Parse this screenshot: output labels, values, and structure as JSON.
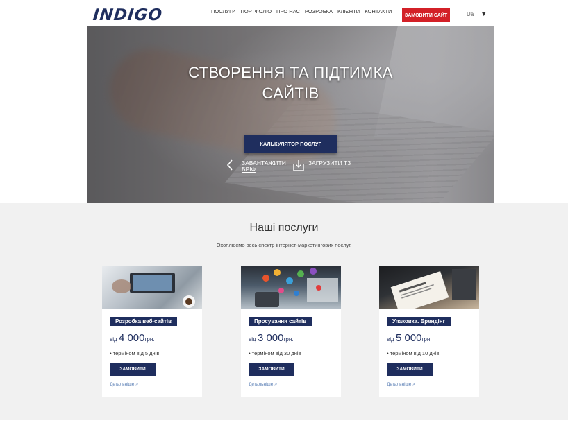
{
  "header": {
    "logo": "INDIGO",
    "nav": [
      "ПОСЛУГИ",
      "ПОРТФОЛІО",
      "ПРО НАС",
      "РОЗРОБКА",
      "КЛІЄНТИ",
      "КОНТАКТИ"
    ],
    "order_label": "ЗАМОВИТИ САЙТ",
    "lang": "Ua"
  },
  "hero": {
    "title_line1": "СТВОРЕННЯ ТА ПІДТИМКА",
    "title_line2": "САЙТІВ",
    "calc_label": "КАЛЬКУЛЯТОР ПОСЛУГ",
    "download_line1": "ЗАВАНТАЖИТИ",
    "download_line2": "БРІФ",
    "upload_label": "ЗАГРУЗИТИ ТЗ"
  },
  "services": {
    "title": "Наші послуги",
    "subtitle": "Охоплюємо весь спектр інтернет-маркетингових послуг.",
    "cards": [
      {
        "name": "Розробка веб-сайтів",
        "from": "від",
        "price": "4 000",
        "currency": "грн.",
        "term": "терміном від 5 днів",
        "buy": "ЗАМОВИТИ",
        "more": "Детальніше >"
      },
      {
        "name": "Просування сайтів",
        "from": "від",
        "price": "3 000",
        "currency": "грн.",
        "term": "терміном від 30 днів",
        "buy": "ЗАМОВИТИ",
        "more": "Детальніше >"
      },
      {
        "name": "Упаковка. Брендінг",
        "from": "від",
        "price": "5 000",
        "currency": "грн.",
        "term": "терміном від 10 днів",
        "buy": "ЗАМОВИТИ",
        "more": "Детальніше >"
      }
    ]
  },
  "colors": {
    "brand": "#1f2e5e",
    "accent": "#d32027",
    "section_bg": "#f1f1f1",
    "link": "#5b7fb5"
  }
}
